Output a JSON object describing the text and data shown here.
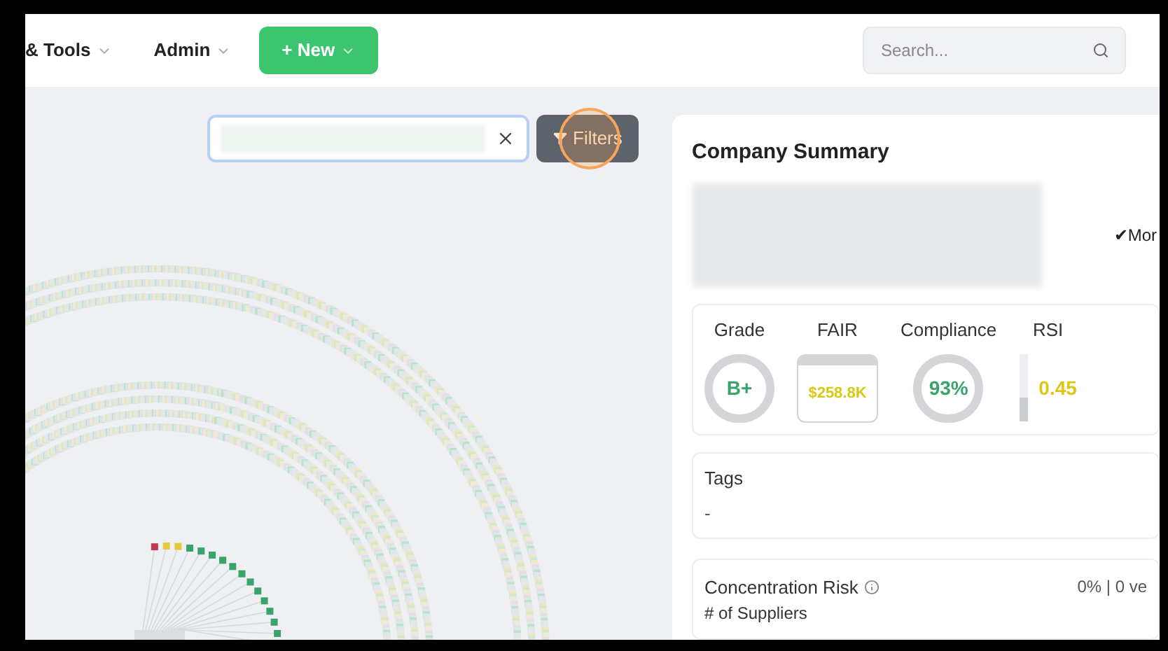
{
  "nav": {
    "items": [
      {
        "label": "& Tools"
      },
      {
        "label": "Admin"
      }
    ],
    "new_button": {
      "label": "+ New"
    },
    "search": {
      "placeholder": "Search..."
    }
  },
  "toolbar": {
    "filters_button": {
      "label": "Filters"
    }
  },
  "summary": {
    "title": "Company Summary",
    "monitor_label": "✔Mor",
    "metrics": [
      {
        "kind": "ring",
        "label": "Grade",
        "value": "B+"
      },
      {
        "kind": "box",
        "label": "FAIR",
        "value": "$258.8K"
      },
      {
        "kind": "ring",
        "label": "Compliance",
        "value": "93%"
      },
      {
        "kind": "bar",
        "label": "RSI",
        "value": "0.45",
        "level": 0.35
      }
    ],
    "tags": {
      "title": "Tags",
      "value": "-"
    },
    "concentration": {
      "title": "Concentration Risk",
      "value": "0% | 0 ve",
      "next_label": "# of Suppliers"
    }
  }
}
